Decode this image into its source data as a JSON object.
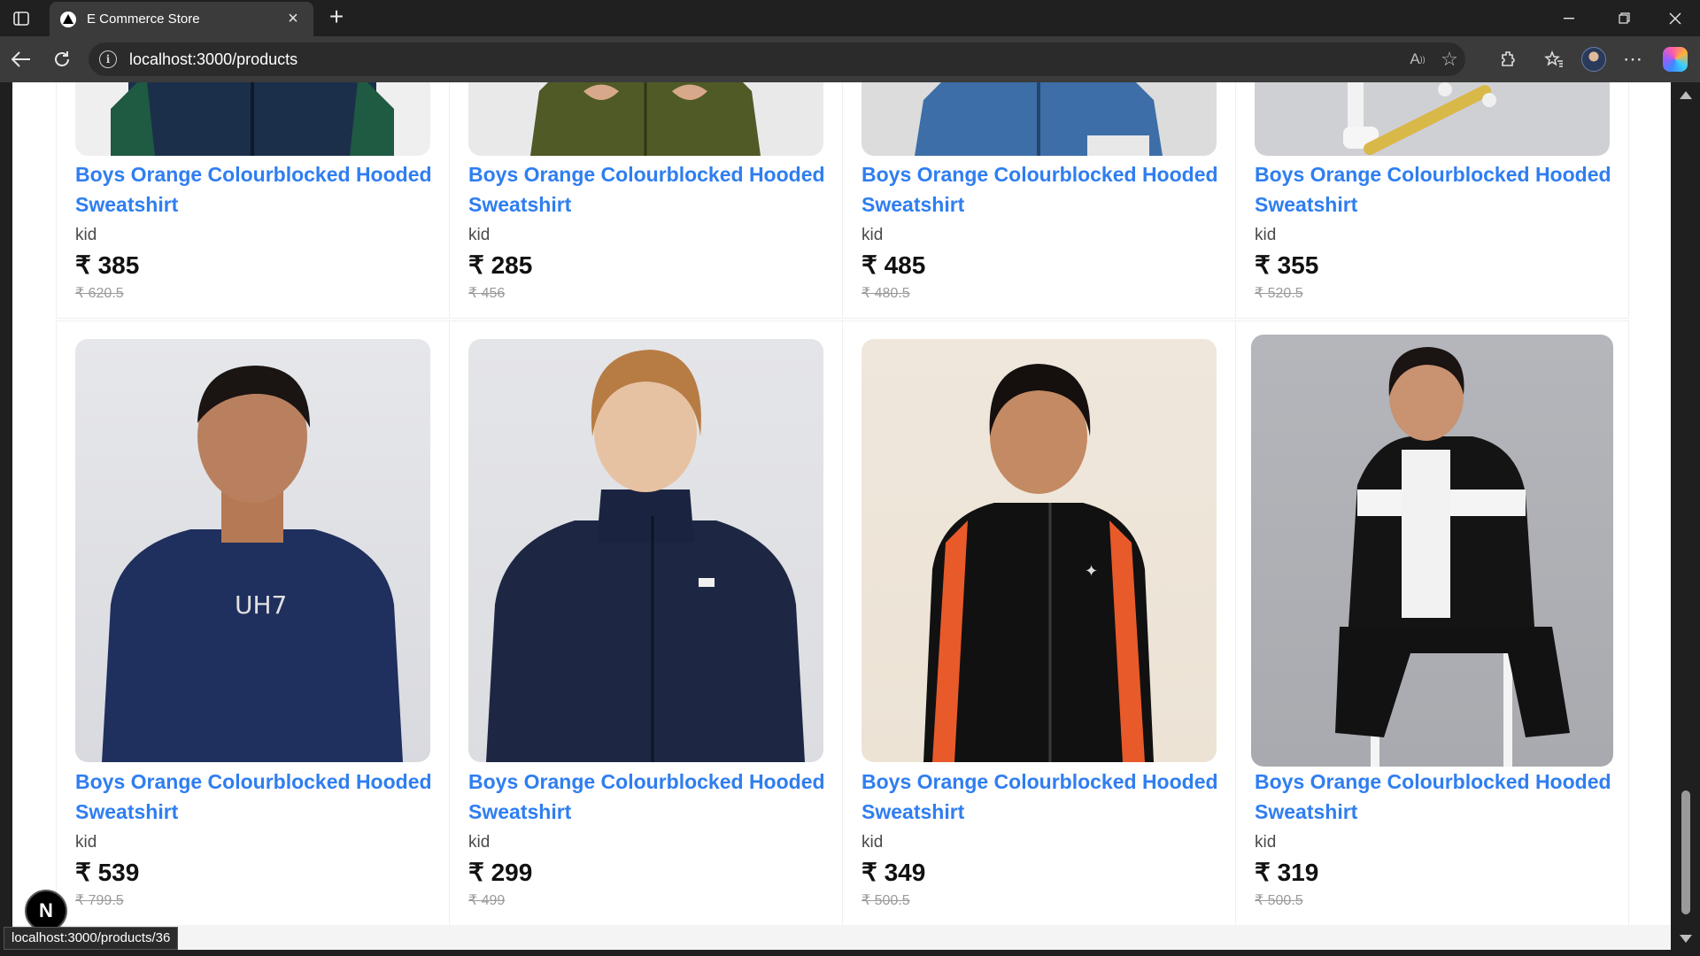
{
  "browser": {
    "tab_title": "E Commerce Store",
    "url": "localhost:3000/products",
    "status_url": "localhost:3000/products/36"
  },
  "nextjs_badge": "N",
  "products_top": [
    {
      "title": "Boys Orange Colourblocked Hooded Sweatshirt",
      "category": "kid",
      "price": "₹ 385",
      "mrp": "₹ 620.5"
    },
    {
      "title": "Boys Orange Colourblocked Hooded Sweatshirt",
      "category": "kid",
      "price": "₹ 285",
      "mrp": "₹ 456"
    },
    {
      "title": "Boys Orange Colourblocked Hooded Sweatshirt",
      "category": "kid",
      "price": "₹ 485",
      "mrp": "₹ 480.5"
    },
    {
      "title": "Boys Orange Colourblocked Hooded Sweatshirt",
      "category": "kid",
      "price": "₹ 355",
      "mrp": "₹ 520.5"
    }
  ],
  "products": [
    {
      "title": "Boys Orange Colourblocked Hooded Sweatshirt",
      "category": "kid",
      "price": "₹ 539",
      "mrp": "₹ 799.5"
    },
    {
      "title": "Boys Orange Colourblocked Hooded Sweatshirt",
      "category": "kid",
      "price": "₹ 299",
      "mrp": "₹ 499"
    },
    {
      "title": "Boys Orange Colourblocked Hooded Sweatshirt",
      "category": "kid",
      "price": "₹ 349",
      "mrp": "₹ 500.5"
    },
    {
      "title": "Boys Orange Colourblocked Hooded Sweatshirt",
      "category": "kid",
      "price": "₹ 319",
      "mrp": "₹ 500.5"
    }
  ],
  "colors": {
    "title_link": "#2f7ef0",
    "chrome_dark": "#202020",
    "toolbar": "#3b3b3b"
  }
}
